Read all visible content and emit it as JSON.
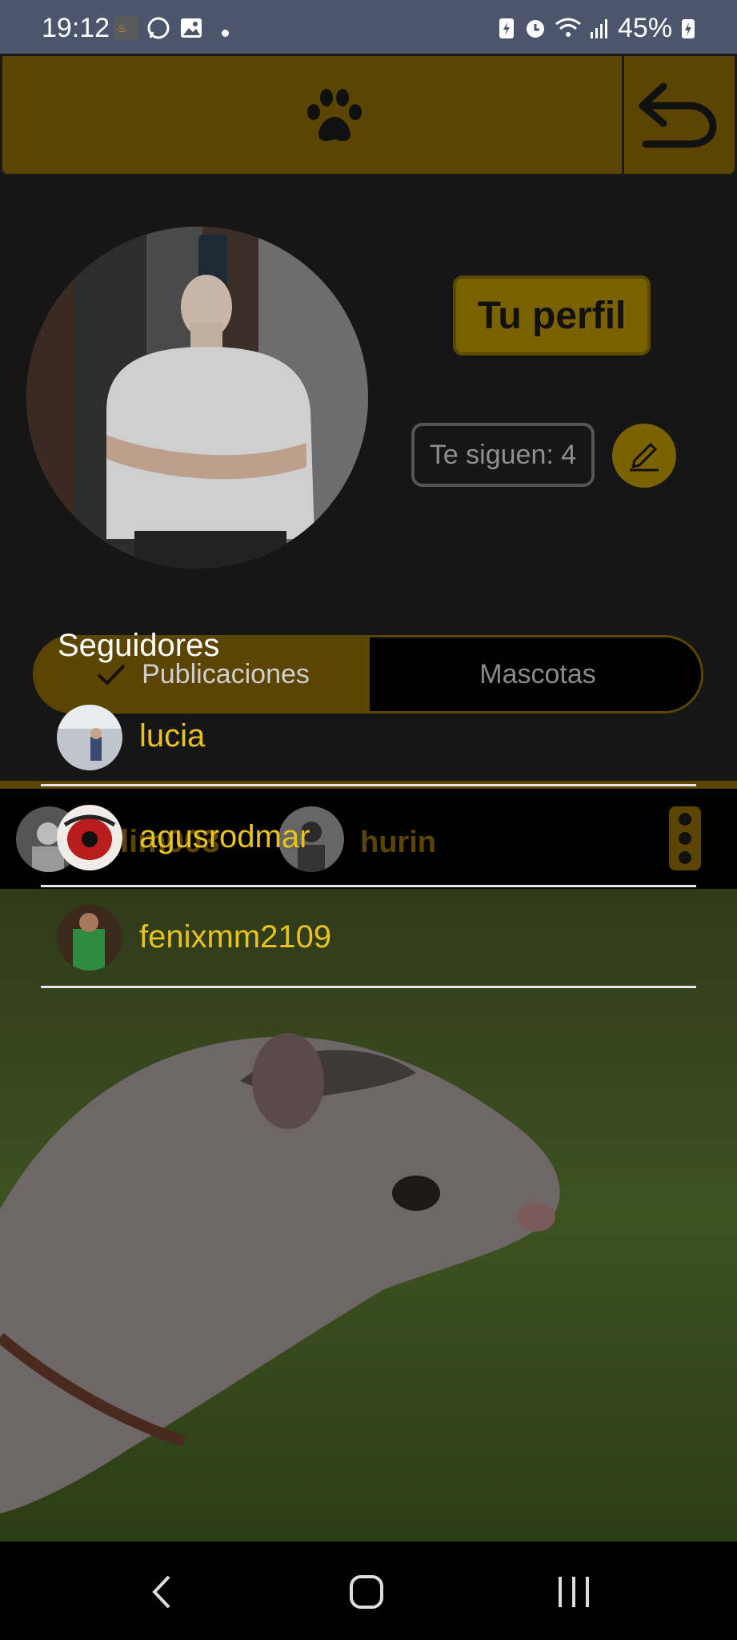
{
  "status_bar": {
    "time": "19:12",
    "battery": "45%",
    "icons": [
      "app-icon",
      "whatsapp-icon",
      "gallery-icon",
      "dot-icon",
      "battery-saver-icon",
      "alarm-icon",
      "wifi-icon",
      "signal-icon",
      "battery-icon"
    ]
  },
  "header": {
    "logo_icon": "paw-icon",
    "back_icon": "back-arrow-icon"
  },
  "profile": {
    "title_button": "Tu perfil",
    "followers_count": "Te siguen: 4",
    "edit_icon": "pencil-icon"
  },
  "tabs": {
    "publications": "Publicaciones",
    "pets": "Mascotas",
    "selected": "Publicaciones"
  },
  "followers": {
    "heading": "Seguidores",
    "items": [
      {
        "name": "lucia"
      },
      {
        "name": "agusrodmar"
      },
      {
        "name": "fenixmm2109"
      }
    ]
  },
  "card": {
    "user_partial": "lim003",
    "user2": "hurin",
    "more_icon": "more-vertical-icon"
  },
  "navbar": {
    "back": "back-nav-icon",
    "home": "home-nav-icon",
    "recents": "recents-nav-icon"
  },
  "colors": {
    "accent": "#5c4500",
    "gold_text": "#e8c21d",
    "background": "#161616",
    "status_bar": "#4b556b"
  }
}
